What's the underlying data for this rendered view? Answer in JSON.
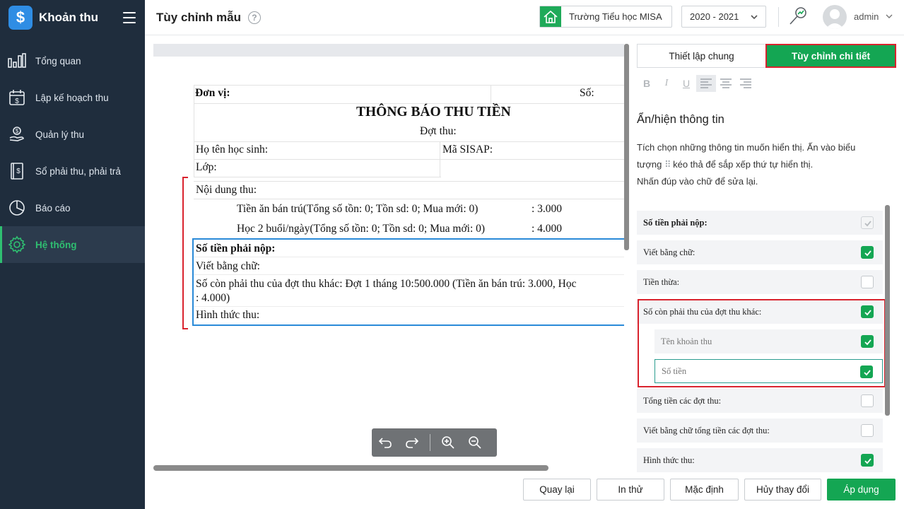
{
  "sidebar": {
    "brand": "Khoản thu",
    "items": [
      {
        "label": "Tổng quan",
        "icon": "chart-bars-icon"
      },
      {
        "label": "Lập kế hoạch thu",
        "icon": "calendar-dollar-icon"
      },
      {
        "label": "Quản lý thu",
        "icon": "hand-coin-icon"
      },
      {
        "label": "Sổ phải thu, phải trả",
        "icon": "ledger-book-icon"
      },
      {
        "label": "Báo cáo",
        "icon": "pie-chart-icon"
      },
      {
        "label": "Hệ thống",
        "icon": "gear-icon"
      }
    ],
    "active_index": 5
  },
  "header": {
    "title": "Tùy chỉnh mẫu",
    "school": "Trường Tiểu học MISA",
    "year": "2020 - 2021",
    "user": "admin"
  },
  "document": {
    "don_vi": "Đơn vị:",
    "so": "Số:",
    "heading": "THÔNG BÁO THU TIỀN",
    "dot_thu": "Đợt thu:",
    "ho_ten": "Họ tên học sinh:",
    "ma_sisap": "Mã SISAP:",
    "lop": "Lớp:",
    "noi_dung": "Nội dung thu:",
    "line1_name": "Tiền ăn bán trú",
    "line1_detail": "(Tổng số tồn: 0;  Tồn sd: 0;  Mua mới: 0)",
    "line1_amount": ": 3.000",
    "line2_name": "Học 2 buổi/ngày",
    "line2_detail": "(Tổng số tồn: 0;  Tồn sd: 0;  Mua mới: 0)",
    "line2_amount": ": 4.000",
    "so_tien": "Số tiền phải nộp:",
    "viet_bang_chu": "Viết bằng chữ:",
    "so_con_line1": "Số còn phải thu của đợt thu khác: Đợt 1 tháng 10:500.000 (Tiền ăn bán trú: 3.000, Học",
    "so_con_line2": ": 4.000)",
    "hinh_thuc": "Hình thức thu:"
  },
  "panel": {
    "tab_general": "Thiết lập chung",
    "tab_detail": "Tùy chỉnh chi tiết",
    "format": {
      "bold": "B",
      "italic": "I",
      "underline": "U"
    },
    "section_title": "Ẩn/hiện thông tin",
    "desc1": "Tích chọn những thông tin muốn hiển thị. Ấn vào biểu",
    "desc2a": "tượng",
    "desc2b": "kéo thả để sắp xếp thứ tự hiển thị.",
    "desc3": "Nhấn đúp vào chữ để sửa lại.",
    "options": [
      {
        "label": "Số tiền phải nộp:",
        "checked": true,
        "disabled": true,
        "bold": true
      },
      {
        "label": "Viết bằng chữ:",
        "checked": true
      },
      {
        "label": "Tiền thừa:",
        "checked": false
      },
      {
        "label": "Số còn phải thu của đợt thu khác:",
        "checked": true
      },
      {
        "label": "Tên khoản thu",
        "checked": true,
        "sub": true
      },
      {
        "label": "Số tiền",
        "checked": true,
        "sub": true,
        "selected": true
      },
      {
        "label": "Tổng tiền các đợt thu:",
        "checked": false
      },
      {
        "label": "Viết bằng chữ tổng tiền các đợt thu:",
        "checked": false
      },
      {
        "label": "Hình thức thu:",
        "checked": true
      }
    ]
  },
  "buttons": {
    "back": "Quay lại",
    "print_test": "In thử",
    "default": "Mặc định",
    "cancel": "Hủy thay đổi",
    "apply": "Áp dụng"
  },
  "colors": {
    "sidebar_bg": "#1f2d3d",
    "accent_green": "#14a653",
    "highlight_red": "#d9232e",
    "highlight_blue": "#2a8ad8"
  }
}
